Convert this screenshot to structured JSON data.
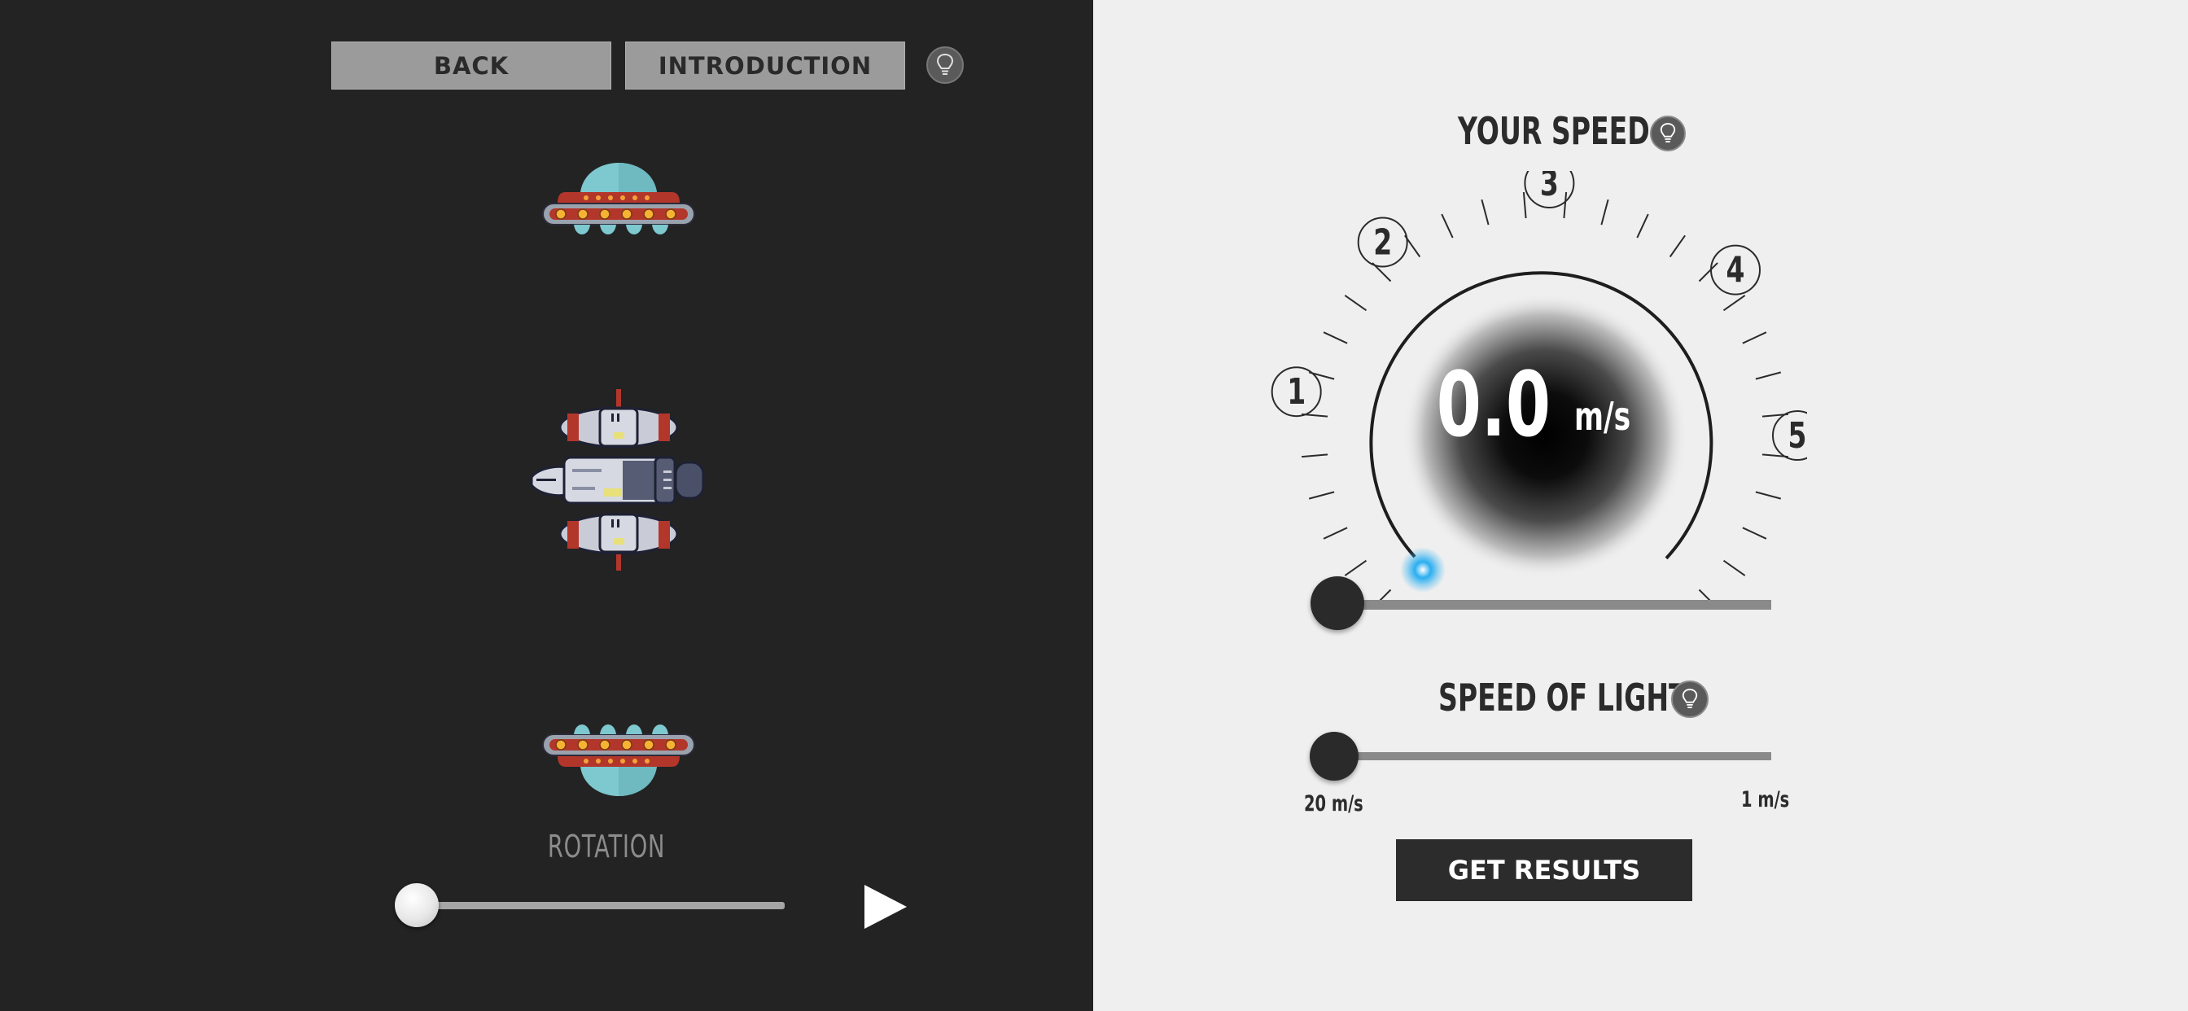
{
  "toolbar": {
    "back_label": "BACK",
    "introduction_label": "INTRODUCTION",
    "hint_icon": "lightbulb-icon"
  },
  "simulation": {
    "ships": [
      "ufo-top",
      "spaceship-center",
      "ufo-bottom"
    ],
    "rotation_label": "ROTATION",
    "rotation_value": 0,
    "play_icon": "play-icon"
  },
  "speed": {
    "title": "YOUR SPEED",
    "value": "0.0",
    "unit": "m/s",
    "markers": [
      "1",
      "2",
      "3",
      "4",
      "5"
    ],
    "slider_value": 0
  },
  "speed_of_light": {
    "title": "SPEED OF LIGHT",
    "min_label": "20 m/s",
    "max_label": "1 m/s",
    "slider_value": 0
  },
  "actions": {
    "get_results_label": "GET RESULTS"
  },
  "colors": {
    "left_background": "#232323",
    "right_background": "#efefef",
    "indicator_blue": "#2aaef0",
    "ufo_dome": "#7ec8cf",
    "ufo_body": "#b3362b"
  }
}
